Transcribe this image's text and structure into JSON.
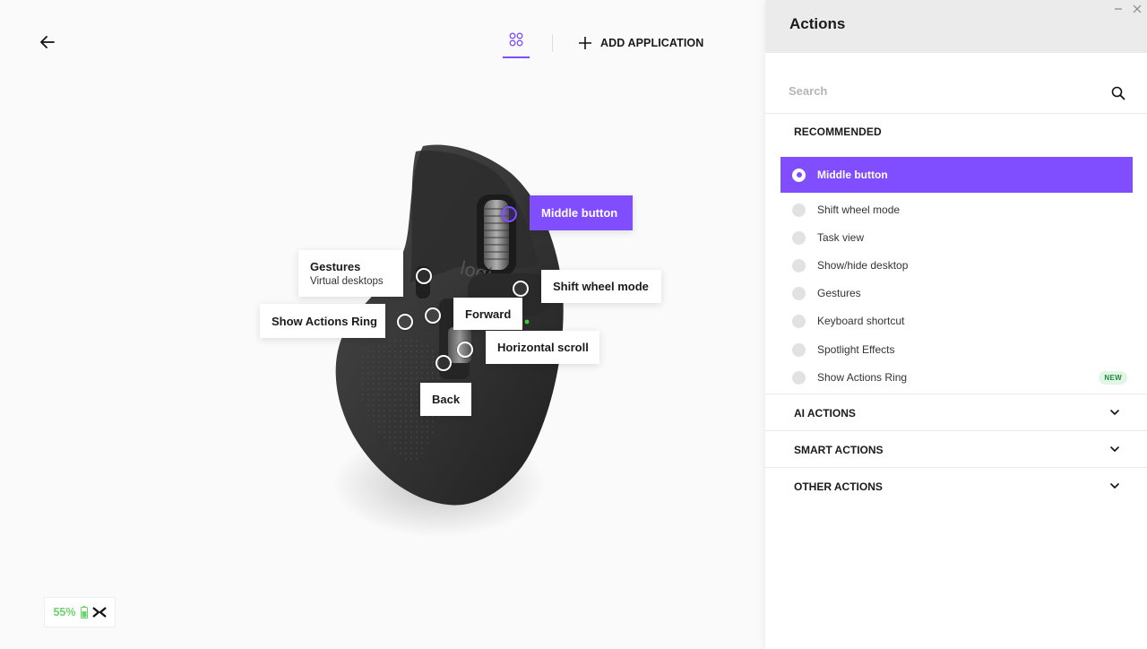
{
  "header": {
    "back_icon": "arrow-left-icon",
    "apps_icon": "app-grid-icon",
    "add_app_label": "ADD APPLICATION",
    "accent": "#814eff"
  },
  "mouse": {
    "logo_text": "logi",
    "callouts": {
      "middle_button": "Middle button",
      "gestures_title": "Gestures",
      "gestures_sub": "Virtual desktops",
      "shift_wheel": "Shift wheel mode",
      "show_actions_ring": "Show Actions Ring",
      "forward": "Forward",
      "horizontal_scroll": "Horizontal scroll",
      "back": "Back"
    }
  },
  "battery": {
    "percent": "55%",
    "battery_icon": "battery-icon",
    "flow_icon": "logi-flow-icon",
    "color": "#6bd36b"
  },
  "panel": {
    "title": "Actions",
    "search_placeholder": "Search",
    "recommended_label": "RECOMMENDED",
    "actions": [
      {
        "label": "Middle button",
        "selected": true
      },
      {
        "label": "Shift wheel mode"
      },
      {
        "label": "Task view"
      },
      {
        "label": "Show/hide desktop"
      },
      {
        "label": "Gestures"
      },
      {
        "label": "Keyboard shortcut"
      },
      {
        "label": "Spotlight Effects"
      },
      {
        "label": "Show Actions Ring",
        "badge": "NEW"
      }
    ],
    "sections": [
      {
        "label": "AI ACTIONS"
      },
      {
        "label": "SMART ACTIONS"
      },
      {
        "label": "OTHER ACTIONS"
      }
    ]
  }
}
